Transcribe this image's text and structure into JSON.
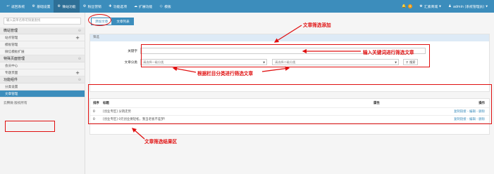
{
  "topbar": {
    "nav": [
      {
        "icon": "arrow-left-icon",
        "glyph": "↩",
        "label": "返回系统"
      },
      {
        "icon": "gear-icon",
        "glyph": "⚙",
        "label": "基础设置"
      },
      {
        "icon": "gear-icon",
        "glyph": "⚙",
        "label": "微站功能",
        "active": true
      },
      {
        "icon": "gear-icon",
        "glyph": "⚙",
        "label": "粉丝营销"
      },
      {
        "icon": "plus-icon",
        "glyph": "✚",
        "label": "功能选项"
      },
      {
        "icon": "cloud-icon",
        "glyph": "☁",
        "label": "扩展功能"
      },
      {
        "icon": "diamond-icon",
        "glyph": "◇",
        "label": "模板"
      }
    ],
    "bell_icon": "bell-icon",
    "notif_count": "0",
    "mall_label": "汇素商城",
    "user_label": "admin (系统管理员)"
  },
  "sidebar": {
    "search_placeholder": "输入菜单名称可快速查找",
    "groups": [
      {
        "title": "微站管理",
        "items": [
          "站点管理",
          "模板管理",
          "微信模板扩展"
        ]
      },
      {
        "title": "特殊页面管理",
        "items": [
          "会员中心",
          "专题页面"
        ]
      },
      {
        "title": "功能组件",
        "items": [
          "分类设置",
          "文章管理"
        ]
      }
    ],
    "copyright": "云腾微 版权所有"
  },
  "main": {
    "tabs": [
      "添加文章",
      "文章列表"
    ],
    "filter": {
      "panel_title": "筛选",
      "keyword_label": "关键字",
      "category_label": "文章分类",
      "cat1_placeholder": "请选择一级分类",
      "cat2_placeholder": "请选择二级分类",
      "search_button": "搜索"
    },
    "table": {
      "headers": [
        "排序",
        "标题",
        "属性",
        "操作"
      ],
      "rows": [
        {
          "order": "0",
          "title": "[创业专区] 分销走势",
          "attr": "",
          "actions": "复制链接 - 编辑 - 删除"
        },
        {
          "order": "0",
          "title": "[创业专区] 0元创业要轻松，我当老板不差梦！",
          "attr": "",
          "actions": "复制链接 - 编辑 - 删除"
        }
      ]
    }
  },
  "annotations": {
    "filter_add": "文章筛选添加",
    "keyword_tip": "输入关键词进行筛选文章",
    "category_tip": "根据栏目分类进行筛选文章",
    "result_area": "文章筛选结果区"
  },
  "colors": {
    "primary": "#3c8dbc",
    "annotation": "#e01010",
    "badge": "#f39c12"
  }
}
